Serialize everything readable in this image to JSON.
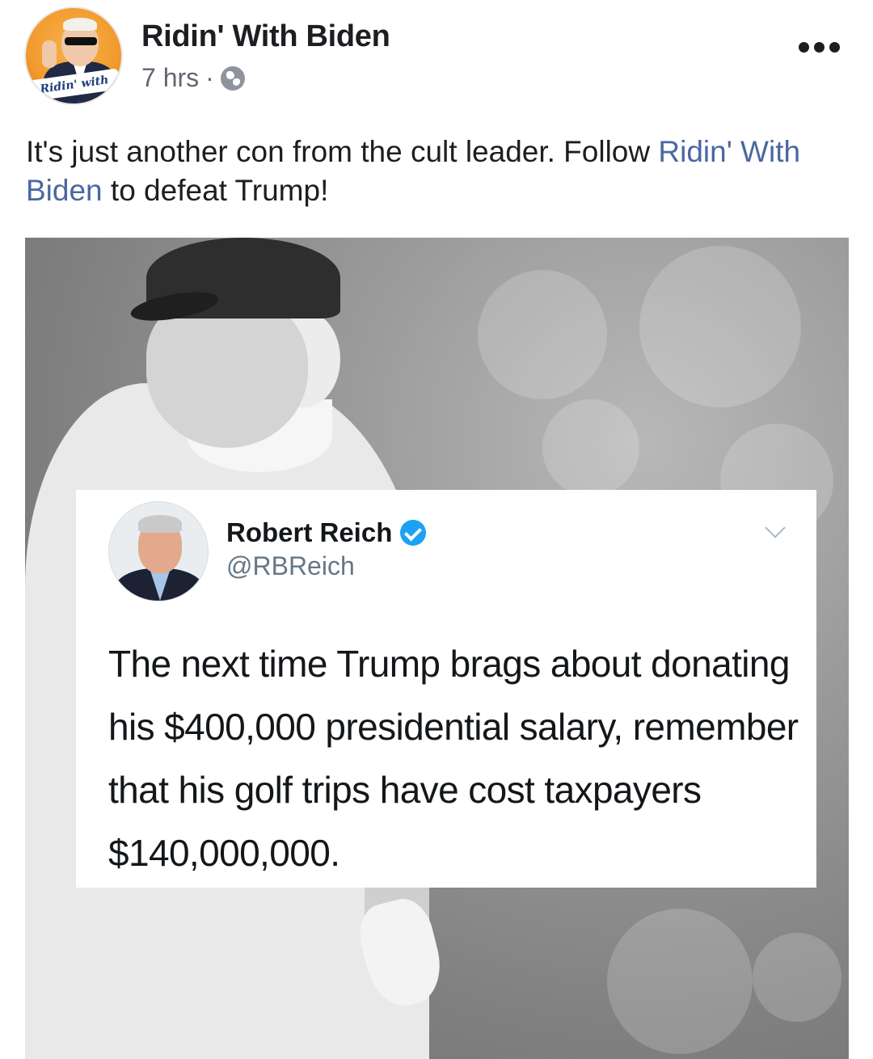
{
  "post": {
    "page_name": "Ridin' With Biden",
    "timestamp": "7 hrs",
    "separator": "·",
    "avatar_logo_text": "Ridin' with Biden",
    "text_before_link": "It's just another con from the cult leader. Follow ",
    "link_text": "Ridin' With Biden",
    "text_after_link": " to defeat Trump!"
  },
  "tweet": {
    "name": "Robert Reich",
    "handle": "@RBReich",
    "body": "The next time Trump brags about donating his $400,000 presidential salary, remember that his golf trips have cost taxpayers $140,000,000."
  },
  "icons": {
    "privacy": "globe-icon",
    "more": "more-options-icon",
    "verified": "verified-icon",
    "tweet_menu": "chevron-down-icon"
  },
  "colors": {
    "link": "#4b67a1",
    "meta_text": "#606770",
    "verified": "#1da1f2"
  }
}
